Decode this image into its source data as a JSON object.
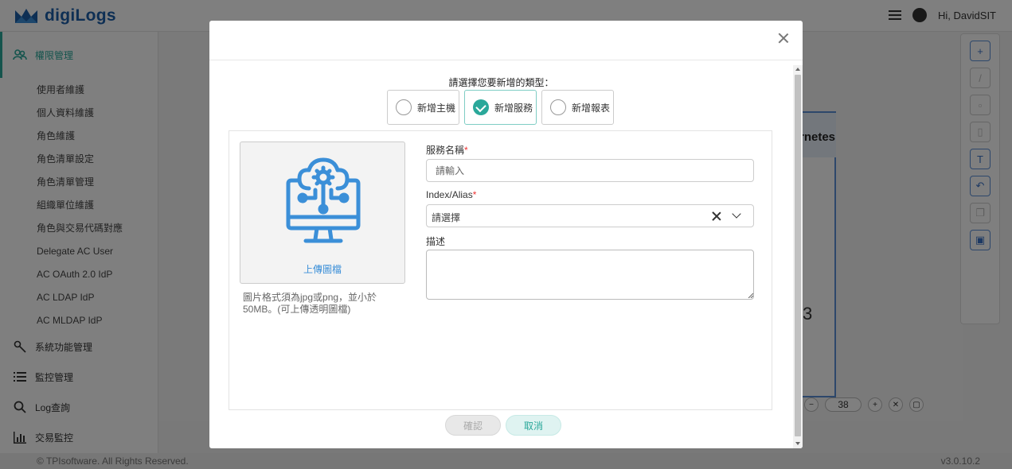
{
  "app": {
    "logo_text": "digiLogs",
    "user_greeting": "Hi, DavidSIT"
  },
  "sidebar": {
    "active_group": "權限管理",
    "sub_items": [
      "使用者維護",
      "個人資料維護",
      "角色維護",
      "角色清單設定",
      "角色清單管理",
      "組織單位維護",
      "角色與交易代碼對應",
      "Delegate AC User",
      "AC OAuth 2.0 IdP",
      "AC LDAP IdP",
      "AC MLDAP IdP"
    ],
    "groups": [
      "系統功能管理",
      "監控管理",
      "Log查詢",
      "交易監控"
    ]
  },
  "background": {
    "card_title_fragment": "rnetes",
    "card_number": "3",
    "zoom_value": "38"
  },
  "footer": {
    "copyright": "© TPIsoftware. All Rights Reserved.",
    "version": "v3.0.10.2"
  },
  "modal": {
    "type_prompt": "請選擇您要新增的類型：",
    "type_options": [
      {
        "label": "新增主機",
        "selected": false
      },
      {
        "label": "新增服務",
        "selected": true
      },
      {
        "label": "新增報表",
        "selected": false
      }
    ],
    "upload": {
      "label": "上傳圖檔",
      "hint": "圖片格式須為jpg或png，並小於50MB。(可上傳透明圖檔)"
    },
    "fields": {
      "service_name": {
        "label": "服務名稱",
        "required": "*",
        "placeholder": "請輸入"
      },
      "index_alias": {
        "label": "Index/Alias",
        "required": "*",
        "value": "請選擇"
      },
      "description": {
        "label": "描述"
      }
    },
    "buttons": {
      "confirm": "確認",
      "cancel": "取消"
    }
  },
  "colors": {
    "accent": "#2aa89a",
    "brand": "#1d5fa8",
    "link": "#3b8fd8",
    "required": "#ee3333"
  }
}
